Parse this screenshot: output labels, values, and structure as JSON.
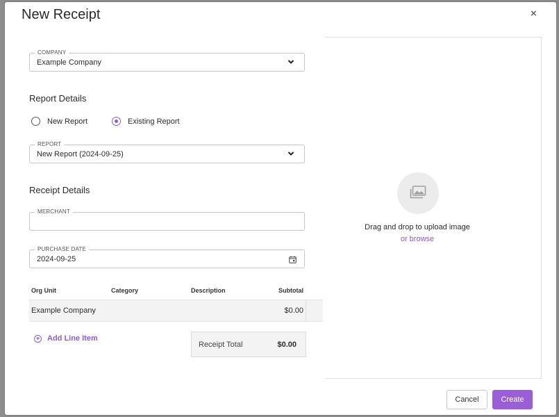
{
  "dialog": {
    "title": "New Receipt",
    "close_symbol": "×"
  },
  "company": {
    "label": "COMPANY",
    "value": "Example Company"
  },
  "report_details": {
    "heading": "Report Details",
    "option_new": "New Report",
    "option_existing": "Existing Report",
    "selected": "Existing Report"
  },
  "report": {
    "label": "REPORT",
    "value": "New Report (2024-09-25)"
  },
  "receipt_details": {
    "heading": "Receipt Details"
  },
  "merchant": {
    "label": "MERCHANT",
    "value": ""
  },
  "purchase_date": {
    "label": "PURCHASE DATE",
    "value": "2024-09-25"
  },
  "table": {
    "headers": {
      "org_unit": "Org Unit",
      "category": "Category",
      "description": "Description",
      "subtotal": "Subtotal"
    },
    "rows": [
      {
        "org_unit": "Example Company",
        "category": "",
        "description": "",
        "subtotal": "$0.00"
      }
    ]
  },
  "add_line_item": "Add Line Item",
  "receipt_total": {
    "label": "Receipt Total",
    "value": "$0.00"
  },
  "upload": {
    "text": "Drag and drop to upload image",
    "browse": "or browse"
  },
  "buttons": {
    "cancel": "Cancel",
    "create": "Create"
  },
  "colors": {
    "accent": "#8d5cd4",
    "create_button": "#9a5fd8"
  },
  "icons": {
    "close": "close-icon",
    "dropdown": "chevron-down-icon",
    "calendar": "calendar-icon",
    "image": "image-icon",
    "add": "plus-circle-icon"
  }
}
